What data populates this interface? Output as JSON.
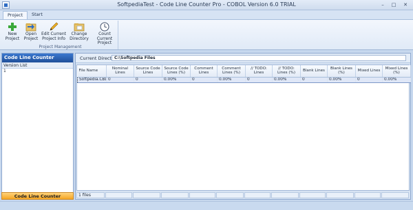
{
  "window": {
    "title": "SoftpediaTest - Code Line Counter Pro - COBOL Version 6.0 TRIAL",
    "minimize_icon": "minimize-icon",
    "maximize_icon": "maximize-icon",
    "close_icon": "close-icon"
  },
  "ribbon": {
    "tabs": [
      {
        "label": "Project",
        "active": true
      },
      {
        "label": "Start",
        "active": false
      }
    ],
    "group_label": "Project Management",
    "buttons": [
      {
        "label": "New Project",
        "icon": "plus-icon"
      },
      {
        "label": "Open Project",
        "icon": "folder-open-icon"
      },
      {
        "label": "Edit Current Project Info",
        "icon": "pencil-icon"
      },
      {
        "label": "Change Directory",
        "icon": "folder-change-icon"
      },
      {
        "label": "Count Current Project",
        "icon": "clock-icon"
      }
    ]
  },
  "left_panel": {
    "title": "Code Line Counter",
    "version_header": "Version List",
    "versions": [
      "1"
    ],
    "footer": "Code Line Counter"
  },
  "right_panel": {
    "current_directory_label": "Current Directory:",
    "current_directory_value": "C:\\Softpedia Files",
    "columns": [
      "File Name",
      "Nominal Lines",
      "Source Code Lines",
      "Source Code Lines (%)",
      "Comment Lines",
      "Comment Lines (%)",
      "// TODO: Lines",
      "// TODO: Lines (%)",
      "Blank Lines",
      "Blank Lines (%)",
      "Mixed Lines",
      "Mixed Lines (%)"
    ],
    "rows": [
      [
        "Softpedia.CBL",
        "0",
        "0",
        "0.00%",
        "0",
        "0.00%",
        "0",
        "0.00%",
        "0",
        "0.00%",
        "0",
        "0.00%"
      ]
    ],
    "status_cells": [
      "1 files",
      "",
      "",
      "",
      "",
      "",
      "",
      "",
      "",
      "",
      "",
      ""
    ]
  }
}
